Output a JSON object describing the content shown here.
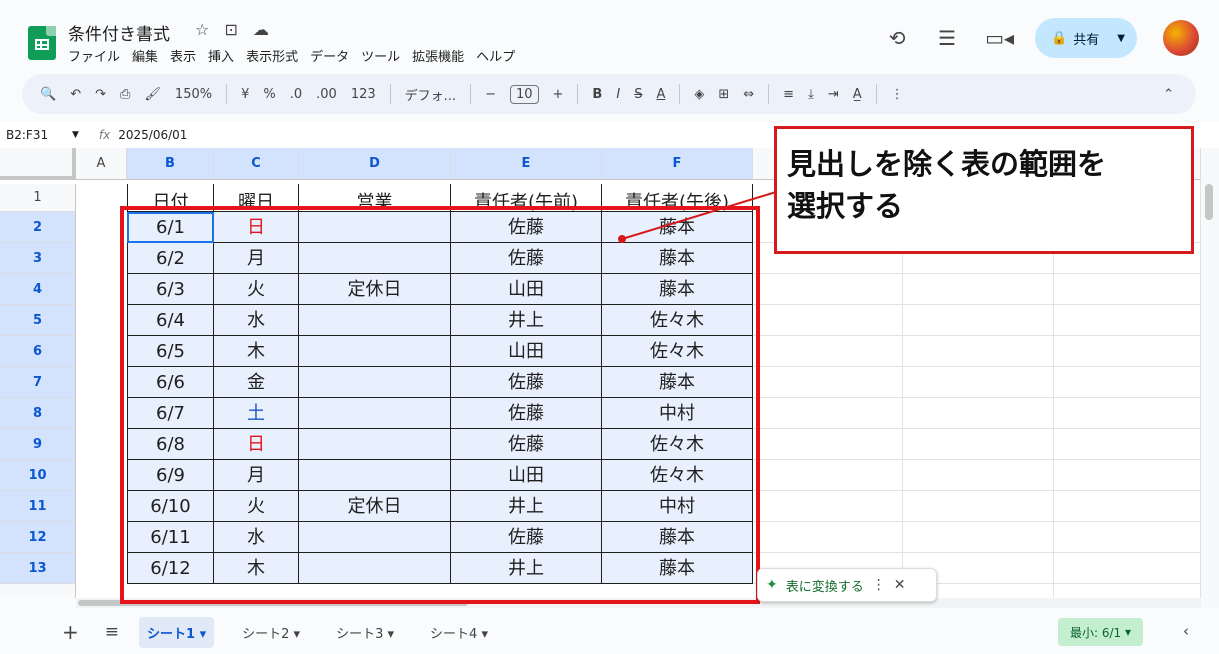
{
  "app": {
    "title": "条件付き書式"
  },
  "menu": [
    "ファイル",
    "編集",
    "表示",
    "挿入",
    "表示形式",
    "データ",
    "ツール",
    "拡張機能",
    "ヘルプ"
  ],
  "header": {
    "share_label": "共有"
  },
  "toolbar": {
    "zoom": "150%",
    "currency": "¥",
    "percent": "%",
    "dec_minus": ".0",
    "dec_plus": ".00",
    "num_format": "123",
    "font": "デフォ...",
    "font_size": "10",
    "bold": "B",
    "italic": "I"
  },
  "formula": {
    "name_box": "B2:F31",
    "fx": "fx",
    "value": "2025/06/01"
  },
  "grid": {
    "col_headers": [
      "A",
      "B",
      "C",
      "D",
      "E",
      "F"
    ],
    "header_row": {
      "row": "1",
      "b": "日付",
      "c": "曜日",
      "d": "営業",
      "e": "責任者(午前)",
      "f": "責任者(午後)"
    },
    "rows": [
      {
        "row": "2",
        "b": "6/1",
        "c": "日",
        "d": "",
        "e": "佐藤",
        "f": "藤本"
      },
      {
        "row": "3",
        "b": "6/2",
        "c": "月",
        "d": "",
        "e": "佐藤",
        "f": "藤本"
      },
      {
        "row": "4",
        "b": "6/3",
        "c": "火",
        "d": "定休日",
        "e": "山田",
        "f": "藤本"
      },
      {
        "row": "5",
        "b": "6/4",
        "c": "水",
        "d": "",
        "e": "井上",
        "f": "佐々木"
      },
      {
        "row": "6",
        "b": "6/5",
        "c": "木",
        "d": "",
        "e": "山田",
        "f": "佐々木"
      },
      {
        "row": "7",
        "b": "6/6",
        "c": "金",
        "d": "",
        "e": "佐藤",
        "f": "藤本"
      },
      {
        "row": "8",
        "b": "6/7",
        "c": "土",
        "d": "",
        "e": "佐藤",
        "f": "中村"
      },
      {
        "row": "9",
        "b": "6/8",
        "c": "日",
        "d": "",
        "e": "佐藤",
        "f": "佐々木"
      },
      {
        "row": "10",
        "b": "6/9",
        "c": "月",
        "d": "",
        "e": "山田",
        "f": "佐々木"
      },
      {
        "row": "11",
        "b": "6/10",
        "c": "火",
        "d": "定休日",
        "e": "井上",
        "f": "中村"
      },
      {
        "row": "12",
        "b": "6/11",
        "c": "水",
        "d": "",
        "e": "佐藤",
        "f": "藤本"
      },
      {
        "row": "13",
        "b": "6/12",
        "c": "木",
        "d": "",
        "e": "井上",
        "f": "藤本"
      }
    ]
  },
  "colors": {
    "sunday": "#e5141b",
    "saturday": "#1a57c9",
    "selection": "#e8f0fe",
    "callout_border": "#d6191b"
  },
  "callout": {
    "line1": "見出しを除く表の範囲を",
    "line2": "選択する"
  },
  "convert_chip": {
    "label": "表に変換する"
  },
  "sheets": [
    {
      "label": "シート1",
      "active": true
    },
    {
      "label": "シート2",
      "active": false
    },
    {
      "label": "シート3",
      "active": false
    },
    {
      "label": "シート4",
      "active": false
    }
  ],
  "status": {
    "summary": "最小: 6/1"
  }
}
